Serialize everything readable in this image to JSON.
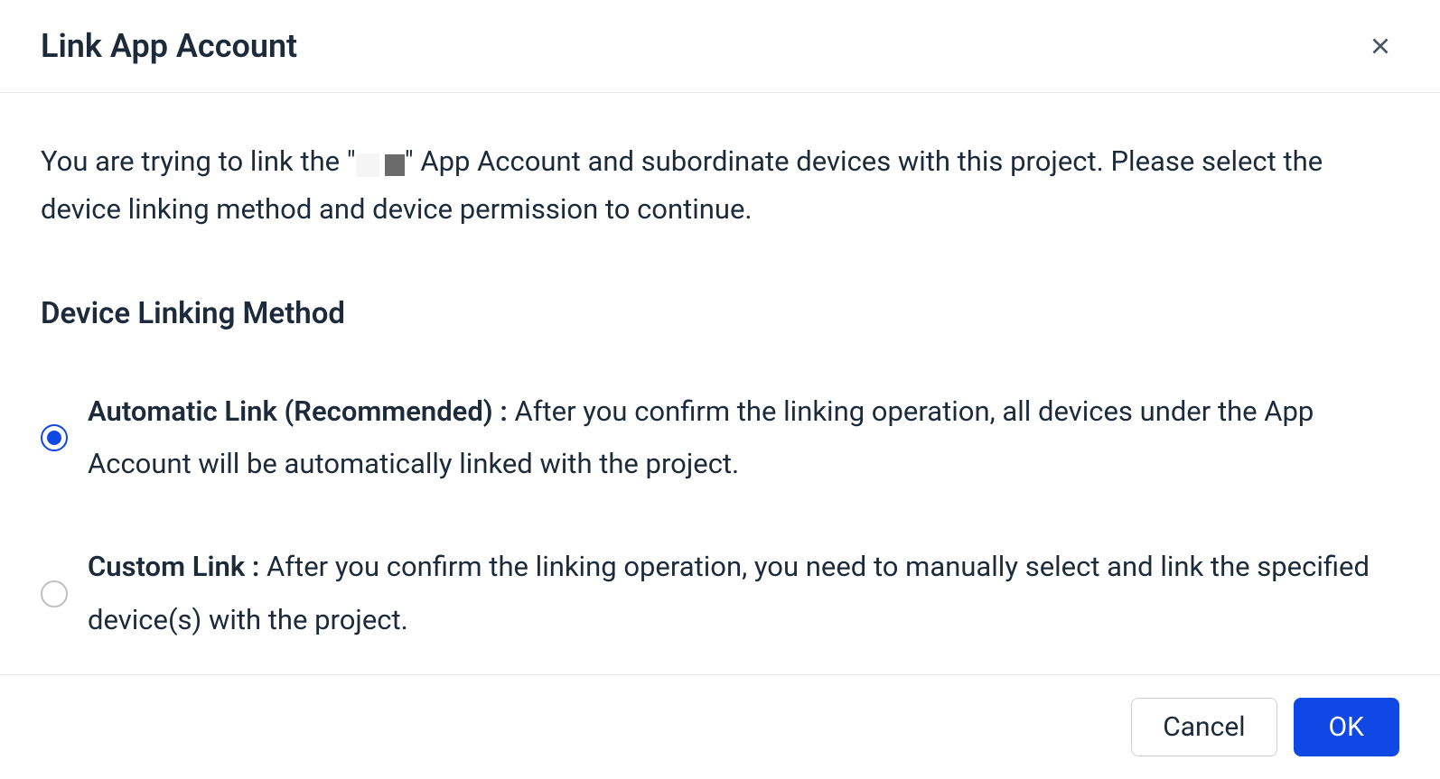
{
  "dialog": {
    "title": "Link App Account",
    "intro_pre": "You are trying to link the \"",
    "intro_post": "\" App Account and subordinate devices with this project. Please select the device linking method and device permission to continue.",
    "section_title": "Device Linking Method",
    "options": [
      {
        "selected": true,
        "label_bold": "Automatic Link (Recommended) :",
        "label_rest": " After you confirm the linking operation, all devices under the App Account will be automatically linked with the project."
      },
      {
        "selected": false,
        "label_bold": "Custom Link :",
        "label_rest": " After you confirm the linking operation, you need to manually select and link the specified device(s) with the project."
      }
    ],
    "footer": {
      "cancel": "Cancel",
      "ok": "OK"
    }
  }
}
